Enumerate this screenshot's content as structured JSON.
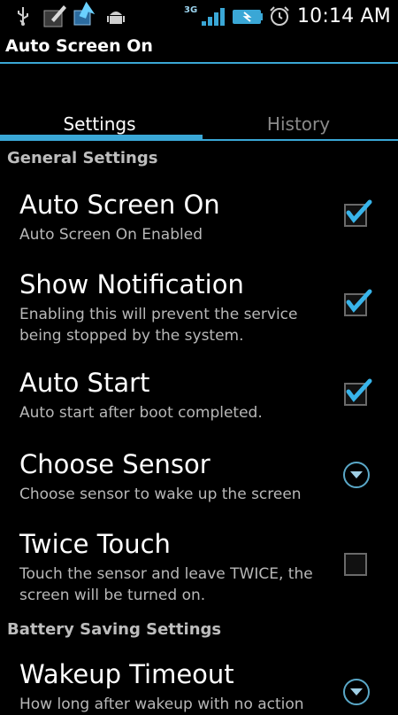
{
  "status_bar": {
    "network_label": "3G",
    "time": "10:14 AM",
    "icons": [
      "usb-icon",
      "pen-icon",
      "download-icon",
      "android-icon",
      "signal-icon",
      "battery-icon",
      "alarm-icon"
    ]
  },
  "app": {
    "title": "Auto Screen On"
  },
  "tabs": [
    {
      "label": "Settings",
      "active": true
    },
    {
      "label": "History",
      "active": false
    }
  ],
  "sections": {
    "general": "General Settings",
    "battery": "Battery Saving Settings"
  },
  "prefs": [
    {
      "title": "Auto Screen On",
      "summary": "Auto Screen On Enabled",
      "control": "checkbox",
      "checked": true
    },
    {
      "title": "Show Notification",
      "summary": "Enabling this will prevent the service being stopped by the system.",
      "control": "checkbox",
      "checked": true
    },
    {
      "title": "Auto Start",
      "summary": "Auto start after boot completed.",
      "control": "checkbox",
      "checked": true
    },
    {
      "title": "Choose Sensor",
      "summary": "Choose sensor to wake up the screen",
      "control": "dropdown"
    },
    {
      "title": "Twice Touch",
      "summary": "Touch the sensor and leave TWICE, the screen will be turned on.",
      "control": "checkbox",
      "checked": false
    },
    {
      "title": "Wakeup Timeout",
      "summary": "How long after wakeup with no action",
      "control": "dropdown"
    }
  ],
  "colors": {
    "accent": "#3aa7d6",
    "background": "#000000"
  }
}
